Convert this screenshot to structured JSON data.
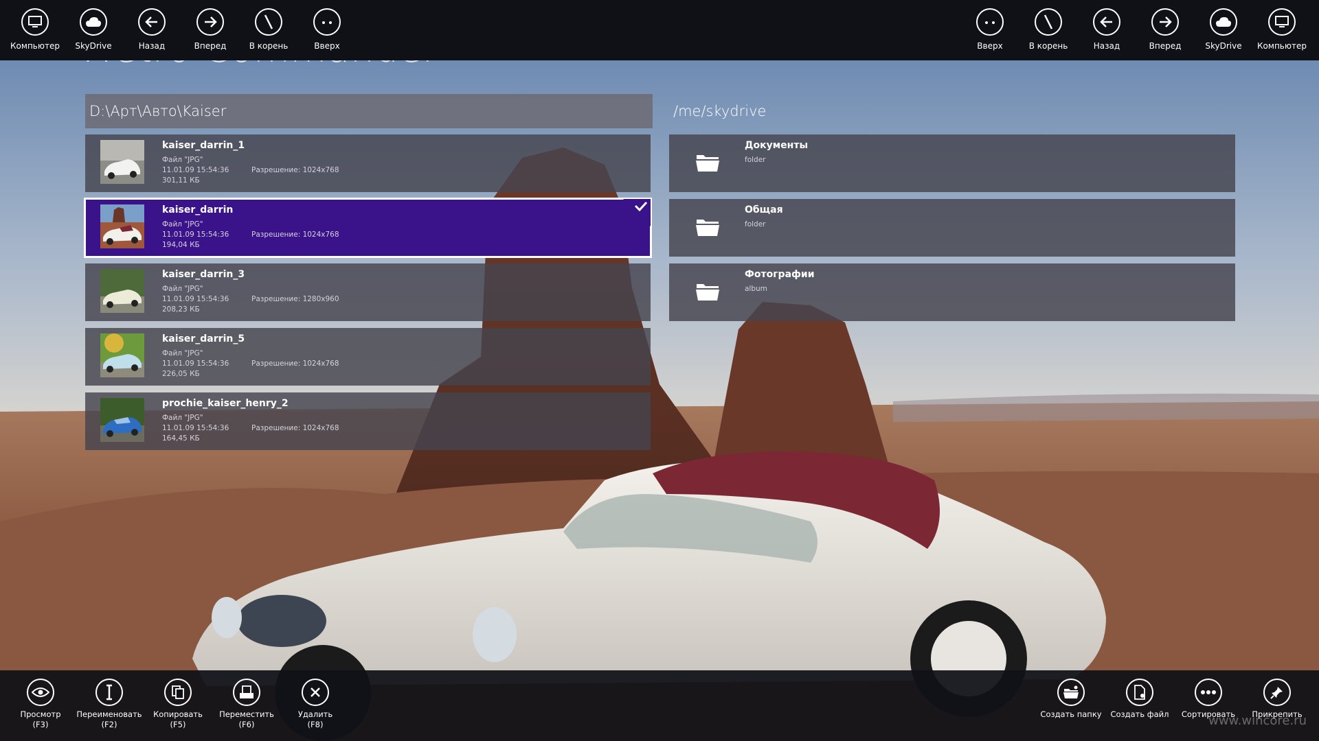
{
  "app": {
    "title": "Metro Commander"
  },
  "top_left_nav": [
    {
      "label": "Компьютер",
      "icon": "computer-icon"
    },
    {
      "label": "SkyDrive",
      "icon": "cloud-icon"
    },
    {
      "label": "Назад",
      "icon": "back-arrow-icon"
    },
    {
      "label": "Вперед",
      "icon": "forward-arrow-icon"
    },
    {
      "label": "В корень",
      "icon": "root-icon"
    },
    {
      "label": "Вверх",
      "icon": "up-dots-icon"
    }
  ],
  "top_right_nav": [
    {
      "label": "Вверх",
      "icon": "up-dots-icon"
    },
    {
      "label": "В корень",
      "icon": "root-icon"
    },
    {
      "label": "Назад",
      "icon": "back-arrow-icon"
    },
    {
      "label": "Вперед",
      "icon": "forward-arrow-icon"
    },
    {
      "label": "SkyDrive",
      "icon": "cloud-icon"
    },
    {
      "label": "Компьютер",
      "icon": "computer-icon"
    }
  ],
  "left_panel": {
    "path": "D:\\Арт\\Авто\\Kaiser",
    "files": [
      {
        "name": "kaiser_darrin_1",
        "type": "Файл \"JPG\"",
        "date": "11.01.09 15:54:36",
        "resolution": "Разрешение: 1024x768",
        "size": "301,11 КБ",
        "selected": false
      },
      {
        "name": "kaiser_darrin",
        "type": "Файл \"JPG\"",
        "date": "11.01.09 15:54:36",
        "resolution": "Разрешение: 1024x768",
        "size": "194,04 КБ",
        "selected": true
      },
      {
        "name": "kaiser_darrin_3",
        "type": "Файл \"JPG\"",
        "date": "11.01.09 15:54:36",
        "resolution": "Разрешение: 1280x960",
        "size": "208,23 КБ",
        "selected": false
      },
      {
        "name": "kaiser_darrin_5",
        "type": "Файл \"JPG\"",
        "date": "11.01.09 15:54:36",
        "resolution": "Разрешение: 1024x768",
        "size": "226,05 КБ",
        "selected": false
      },
      {
        "name": "prochie_kaiser_henry_2",
        "type": "Файл \"JPG\"",
        "date": "11.01.09 15:54:36",
        "resolution": "Разрешение: 1024x768",
        "size": "164,45 КБ",
        "selected": false
      }
    ]
  },
  "right_panel": {
    "path": "/me/skydrive",
    "items": [
      {
        "name": "Документы",
        "kind": "folder"
      },
      {
        "name": "Общая",
        "kind": "folder"
      },
      {
        "name": "Фотографии",
        "kind": "album"
      }
    ]
  },
  "bottom_left_commands": [
    {
      "label": "Просмотр",
      "key": "(F3)",
      "icon": "eye-icon"
    },
    {
      "label": "Переименовать",
      "key": "(F2)",
      "icon": "rename-icon"
    },
    {
      "label": "Копировать",
      "key": "(F5)",
      "icon": "copy-icon"
    },
    {
      "label": "Переместить",
      "key": "(F6)",
      "icon": "move-icon"
    },
    {
      "label": "Удалить",
      "key": "(F8)",
      "icon": "delete-icon"
    }
  ],
  "bottom_right_commands": [
    {
      "label": "Создать папку",
      "icon": "new-folder-icon"
    },
    {
      "label": "Создать файл",
      "icon": "new-file-icon"
    },
    {
      "label": "Сортировать",
      "icon": "sort-dots-icon"
    },
    {
      "label": "Прикрепить",
      "icon": "pin-icon"
    }
  ],
  "watermark": "www.wincore.ru",
  "colors": {
    "selected_row": "#3a138a",
    "bar": "#0f1117",
    "row": "#46444e"
  }
}
